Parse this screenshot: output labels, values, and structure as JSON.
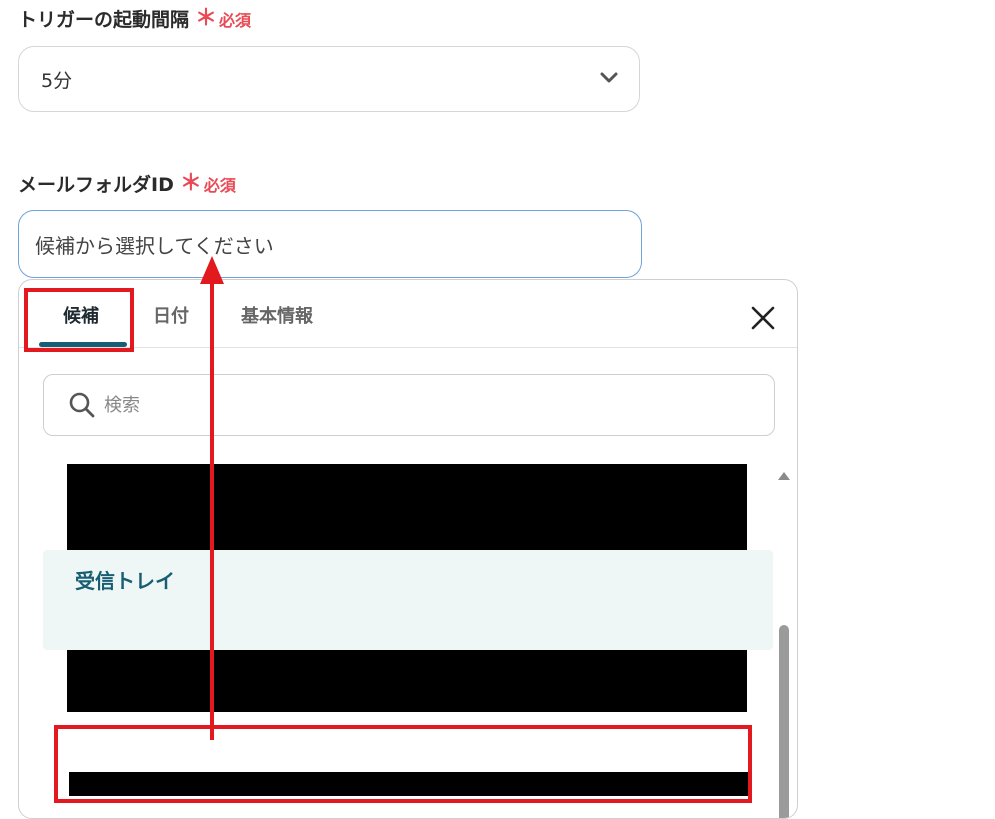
{
  "trigger": {
    "label": "トリガーの起動間隔",
    "required_mark": "＊",
    "required_text": "必須",
    "selected_value": "5分"
  },
  "folder": {
    "label": "メールフォルダID",
    "required_mark": "＊",
    "required_text": "必須",
    "placeholder": "候補から選択してください"
  },
  "panel": {
    "tabs": [
      {
        "label": "候補"
      },
      {
        "label": "日付"
      },
      {
        "label": "基本情報"
      }
    ],
    "search_placeholder": "検索",
    "selected_item_title": "受信トレイ"
  },
  "colors": {
    "accent": "#175e74",
    "required": "#e94a55",
    "highlight": "#e2191f",
    "selected_bg": "#eef7f6"
  }
}
